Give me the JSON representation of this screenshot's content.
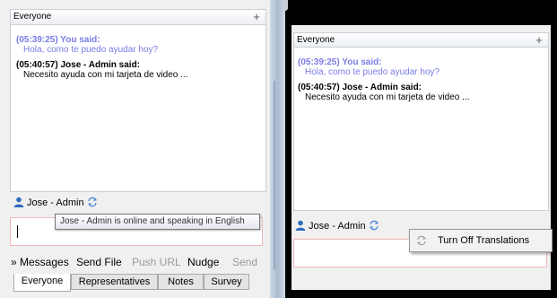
{
  "header": {
    "title": "Everyone"
  },
  "messages": [
    {
      "time": "(05:39:25) You said:",
      "text": "Hola, como te puedo ayudar hoy?"
    },
    {
      "time": "(05:40:57) Jose - Admin said:",
      "text": "Necesito ayuda con mi tarjeta de video ..."
    }
  ],
  "user": {
    "name": "Jose - Admin"
  },
  "tooltip": "Jose - Admin is online and speaking in English",
  "toolbar": {
    "messages": "» Messages",
    "send_file": "Send File",
    "push_url": "Push URL",
    "nudge": "Nudge",
    "send": "Send"
  },
  "tabs": [
    "Everyone",
    "Representatives",
    "Notes",
    "Survey"
  ],
  "context_menu": {
    "item": "Turn Off Translations"
  },
  "colors": {
    "self": "#7b7be8",
    "input_border": "#f0b8b8",
    "user_icon": "#2d6bbf"
  }
}
